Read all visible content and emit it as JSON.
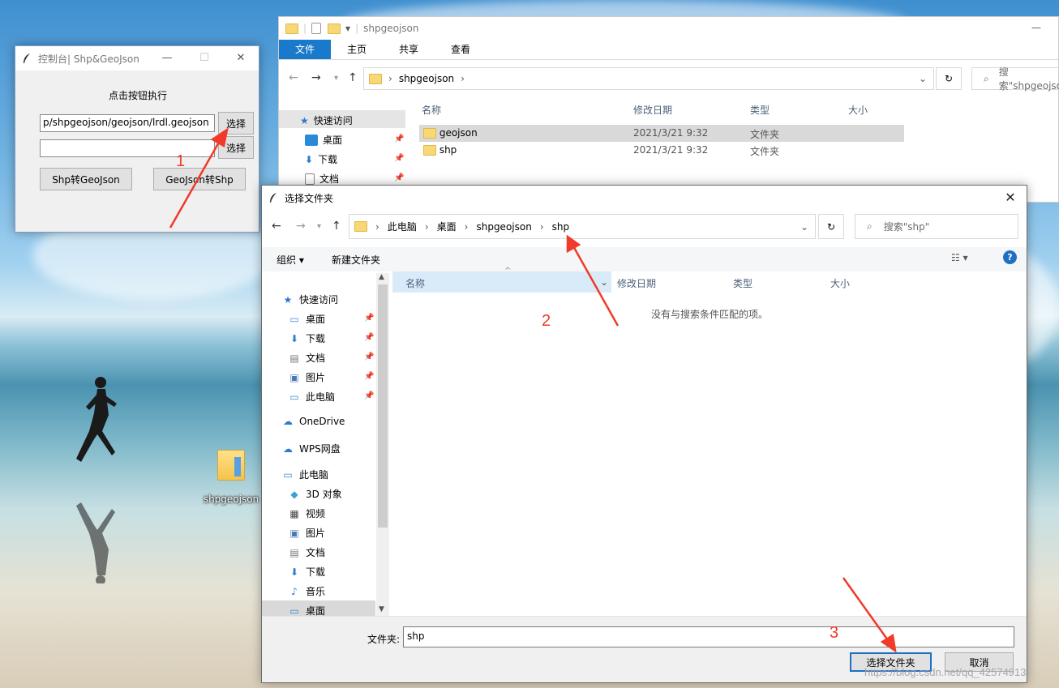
{
  "desktop": {
    "icon_label": "shpgeojson"
  },
  "console": {
    "title": "控制台| Shp&GeoJson",
    "instruction": "点击按钮执行",
    "path_value": "p/shpgeojson/geojson/lrdl.geojson",
    "second_value": "",
    "select_label_1": "选择",
    "select_label_2": "选择",
    "shp_to_geojson": "Shp转GeoJson",
    "geojson_to_shp": "GeoJson转Shp",
    "minimize": "—",
    "maximize": "☐",
    "close": "✕"
  },
  "explorer": {
    "title": "shpgeojson",
    "tabs": [
      "文件",
      "主页",
      "共享",
      "查看"
    ],
    "address": "shpgeojson",
    "search_placeholder": "搜索\"shpgeojson\"",
    "columns": [
      "名称",
      "修改日期",
      "类型",
      "大小"
    ],
    "nav": [
      "快速访问",
      "桌面",
      "下载",
      "文档"
    ],
    "rows": [
      {
        "name": "geojson",
        "date": "2021/3/21 9:32",
        "type": "文件夹"
      },
      {
        "name": "shp",
        "date": "2021/3/21 9:32",
        "type": "文件夹"
      }
    ]
  },
  "dialog": {
    "title": "选择文件夹",
    "breadcrumb": [
      "此电脑",
      "桌面",
      "shpgeojson",
      "shp"
    ],
    "search_placeholder": "搜索\"shp\"",
    "organize": "组织 ▾",
    "new_folder": "新建文件夹",
    "columns": [
      "名称",
      "修改日期",
      "类型",
      "大小"
    ],
    "empty_message": "没有与搜索条件匹配的项。",
    "nav": [
      {
        "label": "快速访问",
        "icon": "star-icon",
        "indent": 0,
        "pinned": false
      },
      {
        "label": "桌面",
        "icon": "desktop-icon",
        "indent": 1,
        "pinned": true
      },
      {
        "label": "下载",
        "icon": "download-icon",
        "indent": 1,
        "pinned": true
      },
      {
        "label": "文档",
        "icon": "document-icon",
        "indent": 1,
        "pinned": true
      },
      {
        "label": "图片",
        "icon": "picture-icon",
        "indent": 1,
        "pinned": true
      },
      {
        "label": "此电脑",
        "icon": "computer-icon",
        "indent": 1,
        "pinned": true
      },
      {
        "label": "OneDrive",
        "icon": "cloud-icon",
        "indent": 0,
        "pinned": false
      },
      {
        "label": "WPS网盘",
        "icon": "cloud-icon",
        "indent": 0,
        "pinned": false
      },
      {
        "label": "此电脑",
        "icon": "computer-icon",
        "indent": 0,
        "pinned": false
      },
      {
        "label": "3D 对象",
        "icon": "cube-icon",
        "indent": 1,
        "pinned": false
      },
      {
        "label": "视频",
        "icon": "video-icon",
        "indent": 1,
        "pinned": false
      },
      {
        "label": "图片",
        "icon": "picture-icon",
        "indent": 1,
        "pinned": false
      },
      {
        "label": "文档",
        "icon": "document-icon",
        "indent": 1,
        "pinned": false
      },
      {
        "label": "下载",
        "icon": "download-icon",
        "indent": 1,
        "pinned": false
      },
      {
        "label": "音乐",
        "icon": "music-icon",
        "indent": 1,
        "pinned": false
      },
      {
        "label": "桌面",
        "icon": "desktop-icon",
        "indent": 1,
        "pinned": false,
        "selected": true
      }
    ],
    "folder_label": "文件夹:",
    "folder_value": "shp",
    "select_folder": "选择文件夹",
    "cancel": "取消",
    "close": "✕"
  },
  "annotations": [
    "1",
    "2",
    "3"
  ],
  "watermark": "https://blog.csdn.net/qq_42574913",
  "colors": {
    "accent": "#1979ca",
    "arrow": "#f03a2a",
    "selected_row": "#d9d9d9",
    "selected_nav": "#cce8ff"
  }
}
